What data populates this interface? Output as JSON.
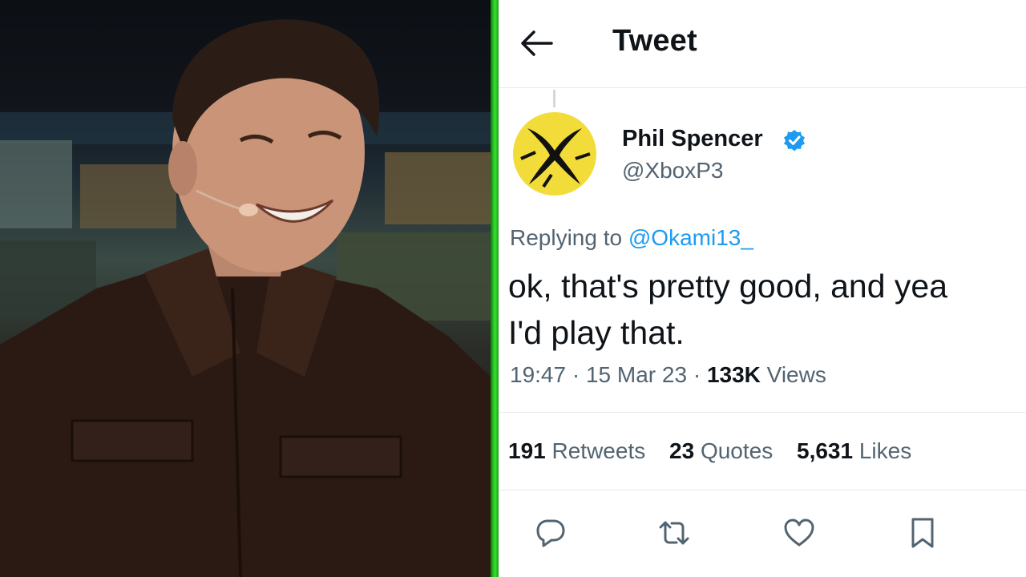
{
  "header": {
    "title": "Tweet"
  },
  "author": {
    "name": "Phil Spencer",
    "handle": "@XboxP3",
    "verified": true
  },
  "reply": {
    "prefix": "Replying to",
    "mention": "@Okami13_"
  },
  "tweet": {
    "text_line1": "ok, that's pretty good, and yea",
    "text_line2": "I'd play that."
  },
  "meta": {
    "time": "19:47",
    "date": "15 Mar 23",
    "views_count": "133K",
    "views_label": "Views"
  },
  "stats": {
    "retweets_count": "191",
    "retweets_label": "Retweets",
    "quotes_count": "23",
    "quotes_label": "Quotes",
    "likes_count": "5,631",
    "likes_label": "Likes"
  },
  "icons": {
    "back": "arrow-left-icon",
    "verified": "verified-badge-icon",
    "reply": "reply-icon",
    "retweet": "retweet-icon",
    "like": "heart-icon",
    "bookmark": "bookmark-icon"
  },
  "colors": {
    "accent": "#1d9bf0",
    "xbox_yellow": "#f2dc3a",
    "divider_green": "#22c41f"
  }
}
